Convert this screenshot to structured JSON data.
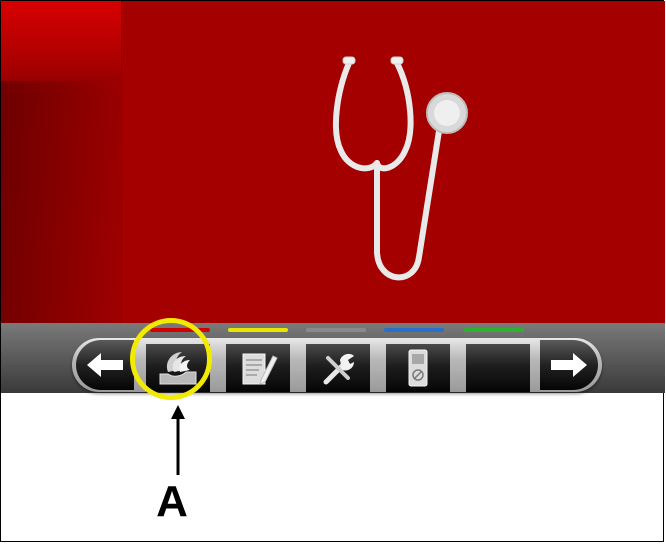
{
  "callout": {
    "label": "A"
  },
  "toolbar": {
    "color_tabs": [
      {
        "color": "#d40000",
        "for": "home-button"
      },
      {
        "color": "#e6e600",
        "for": "notes-button"
      },
      {
        "color": "#8a8a8a",
        "for": "tools-button"
      },
      {
        "color": "#2a70c8",
        "for": "device-button"
      },
      {
        "color": "#30b030",
        "for": "blank-button"
      }
    ],
    "buttons": [
      {
        "icon": "back-arrow-icon"
      },
      {
        "icon": "stack-pages-icon"
      },
      {
        "icon": "notepad-pencil-icon"
      },
      {
        "icon": "tools-icon"
      },
      {
        "icon": "handheld-device-icon"
      },
      {
        "icon": "blank-icon"
      },
      {
        "icon": "forward-arrow-icon"
      }
    ]
  },
  "screen": {
    "background": "#a50000",
    "image": "stethoscope"
  },
  "highlight": {
    "color": "#f2ea00"
  }
}
